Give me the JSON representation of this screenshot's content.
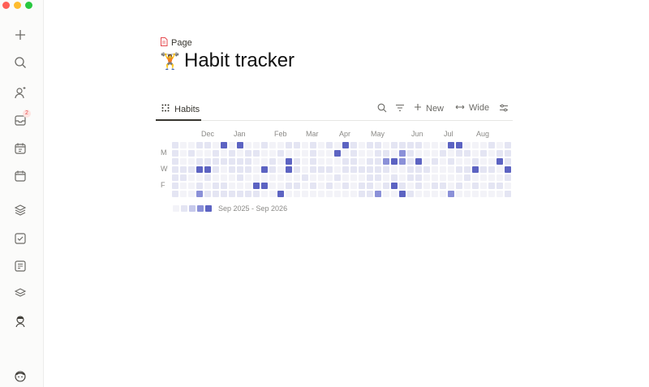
{
  "window": {
    "controls": [
      "close",
      "minimize",
      "maximize"
    ]
  },
  "sidebar": {
    "icons": [
      "plus-icon",
      "search-icon",
      "people-sparkle-icon",
      "inbox-icon",
      "calendar-date-icon",
      "calendar-icon",
      "layers-icon",
      "checkbox-icon",
      "notes-icon",
      "layers-outline-icon",
      "avatar-icon",
      "user-avatar-icon"
    ],
    "inbox_badge": "2"
  },
  "page": {
    "breadcrumb_icon": "page-icon",
    "breadcrumb": "Page",
    "title_icon": "weightlifter-emoji-icon",
    "title": "Habit tracker"
  },
  "view": {
    "tab_icon": "grid-dots-icon",
    "tab_label": "Habits",
    "search_icon": "search-icon",
    "filter_icon": "filter-icon",
    "new_label": "New",
    "wide_label": "Wide",
    "settings_icon": "sliders-icon"
  },
  "heatmap": {
    "months": [
      "Dec",
      "Jan",
      "Feb",
      "Mar",
      "Apr",
      "May",
      "Jun",
      "Jul",
      "Aug"
    ],
    "day_labels": [
      "M",
      "W",
      "F"
    ],
    "range": "Sep 2025 - Sep 2026",
    "legend_levels": [
      0,
      1,
      2,
      3,
      4
    ],
    "colors": [
      "#f3f3f8",
      "#e4e5f3",
      "#c6c9eb",
      "#8a90d8",
      "#5c63c2"
    ],
    "weeks": [
      [
        1,
        1,
        1,
        1,
        1,
        1,
        1
      ],
      [
        0,
        0,
        0,
        1,
        1,
        0,
        0
      ],
      [
        0,
        1,
        0,
        1,
        0,
        0,
        0
      ],
      [
        1,
        0,
        1,
        4,
        0,
        1,
        3
      ],
      [
        1,
        0,
        1,
        4,
        1,
        0,
        1
      ],
      [
        0,
        1,
        1,
        1,
        0,
        1,
        1
      ],
      [
        4,
        0,
        1,
        0,
        0,
        1,
        1
      ],
      [
        0,
        1,
        1,
        1,
        0,
        0,
        1
      ],
      [
        4,
        0,
        1,
        1,
        1,
        0,
        1
      ],
      [
        0,
        1,
        1,
        1,
        0,
        0,
        1
      ],
      [
        0,
        1,
        0,
        0,
        0,
        4,
        1
      ],
      [
        1,
        0,
        0,
        4,
        0,
        4,
        0
      ],
      [
        0,
        0,
        1,
        1,
        0,
        0,
        0
      ],
      [
        0,
        1,
        0,
        0,
        0,
        0,
        4
      ],
      [
        1,
        0,
        4,
        4,
        0,
        1,
        0
      ],
      [
        1,
        0,
        1,
        1,
        0,
        1,
        0
      ],
      [
        0,
        0,
        0,
        0,
        1,
        0,
        0
      ],
      [
        1,
        1,
        1,
        1,
        0,
        1,
        0
      ],
      [
        0,
        0,
        0,
        1,
        0,
        0,
        0
      ],
      [
        1,
        0,
        0,
        1,
        0,
        1,
        0
      ],
      [
        0,
        4,
        0,
        0,
        1,
        0,
        0
      ],
      [
        4,
        0,
        1,
        1,
        0,
        1,
        0
      ],
      [
        1,
        1,
        1,
        1,
        0,
        0,
        0
      ],
      [
        0,
        0,
        0,
        1,
        0,
        1,
        1
      ],
      [
        1,
        0,
        1,
        1,
        1,
        1,
        1
      ],
      [
        1,
        1,
        1,
        1,
        1,
        0,
        3
      ],
      [
        0,
        1,
        3,
        1,
        0,
        1,
        0
      ],
      [
        1,
        0,
        4,
        0,
        1,
        4,
        0
      ],
      [
        1,
        3,
        3,
        0,
        0,
        1,
        4
      ],
      [
        1,
        1,
        1,
        1,
        1,
        0,
        1
      ],
      [
        1,
        0,
        4,
        1,
        1,
        1,
        0
      ],
      [
        0,
        0,
        0,
        1,
        0,
        0,
        0
      ],
      [
        0,
        0,
        1,
        0,
        0,
        1,
        0
      ],
      [
        0,
        1,
        0,
        0,
        0,
        1,
        0
      ],
      [
        4,
        0,
        1,
        0,
        0,
        0,
        3
      ],
      [
        4,
        1,
        0,
        1,
        0,
        1,
        0
      ],
      [
        0,
        1,
        0,
        1,
        1,
        0,
        0
      ],
      [
        0,
        0,
        1,
        4,
        0,
        1,
        0
      ],
      [
        0,
        1,
        0,
        1,
        0,
        0,
        0
      ],
      [
        1,
        0,
        0,
        1,
        0,
        1,
        0
      ],
      [
        0,
        1,
        4,
        0,
        0,
        1,
        0
      ],
      [
        1,
        1,
        1,
        4,
        1,
        0,
        1
      ]
    ]
  }
}
